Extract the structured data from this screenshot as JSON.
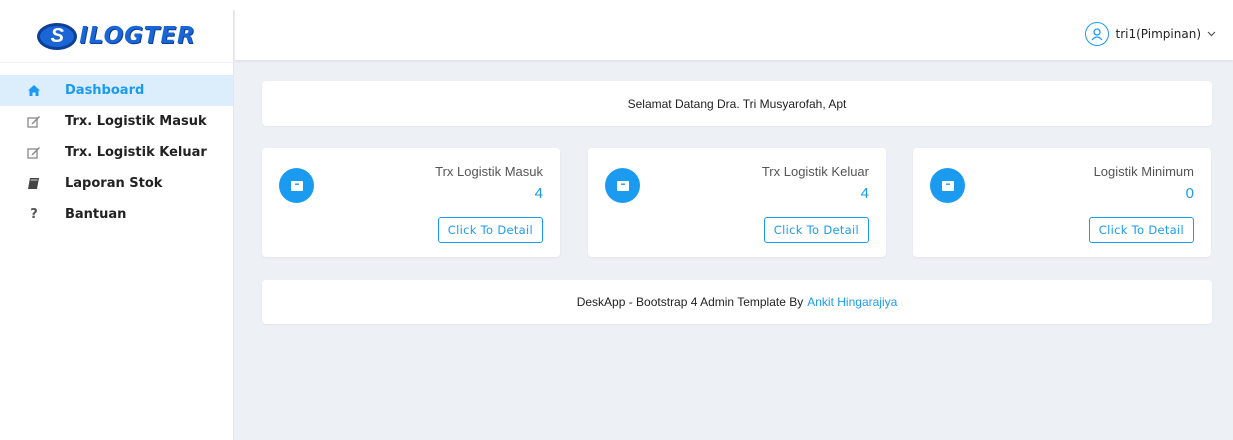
{
  "app": {
    "logo_text": "ILOGTER",
    "logo_letter": "S"
  },
  "colors": {
    "accent": "#1b9bf0",
    "active_bg": "#dcedfb",
    "page_bg": "#edf1f5"
  },
  "sidebar": {
    "items": [
      {
        "label": "Dashboard",
        "icon": "home-icon",
        "active": true
      },
      {
        "label": "Trx. Logistik Masuk",
        "icon": "edit-icon"
      },
      {
        "label": "Trx. Logistik Keluar",
        "icon": "edit-icon"
      },
      {
        "label": "Laporan Stok",
        "icon": "book-icon"
      },
      {
        "label": "Bantuan",
        "icon": "question-icon"
      }
    ]
  },
  "header": {
    "user_name": "tri1(Pimpinan)",
    "user_icon": "user-icon"
  },
  "welcome": {
    "text": "Selamat Datang Dra. Tri Musyarofah, Apt"
  },
  "stats": [
    {
      "title": "Trx Logistik Masuk",
      "value": "4",
      "button": "Click To Detail",
      "icon": "archive-icon"
    },
    {
      "title": "Trx Logistik Keluar",
      "value": "4",
      "button": "Click To Detail",
      "icon": "archive-icon"
    },
    {
      "title": "Logistik Minimum",
      "value": "0",
      "button": "Click To Detail",
      "icon": "archive-icon"
    }
  ],
  "footer": {
    "text": "DeskApp - Bootstrap 4 Admin Template By",
    "link": "Ankit Hingarajiya"
  }
}
